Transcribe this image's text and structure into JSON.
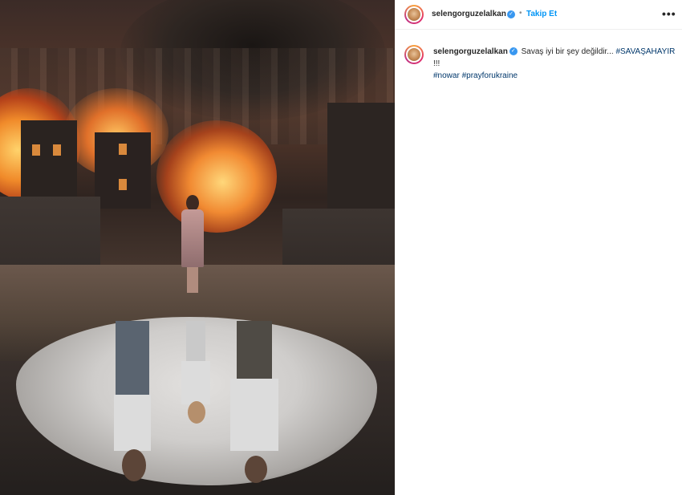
{
  "post": {
    "username": "selengorguzelalkan",
    "follow_label": "Takip Et",
    "separator": "•",
    "more_label": "•••",
    "verified_mark": "✓",
    "caption": {
      "text": "Savaş iyi bir şey değildir...",
      "hashtag_1": "#SAVAŞAHAYIR",
      "trailing": "!!!",
      "hashtag_2": "#nowar",
      "hashtag_3": "#prayforukraine"
    },
    "image_icon": "war-scene-girl-reflection"
  },
  "colors": {
    "link_blue": "#0095f6",
    "hashtag": "#00376b",
    "verified_badge": "#3897f0",
    "text": "#262626"
  }
}
